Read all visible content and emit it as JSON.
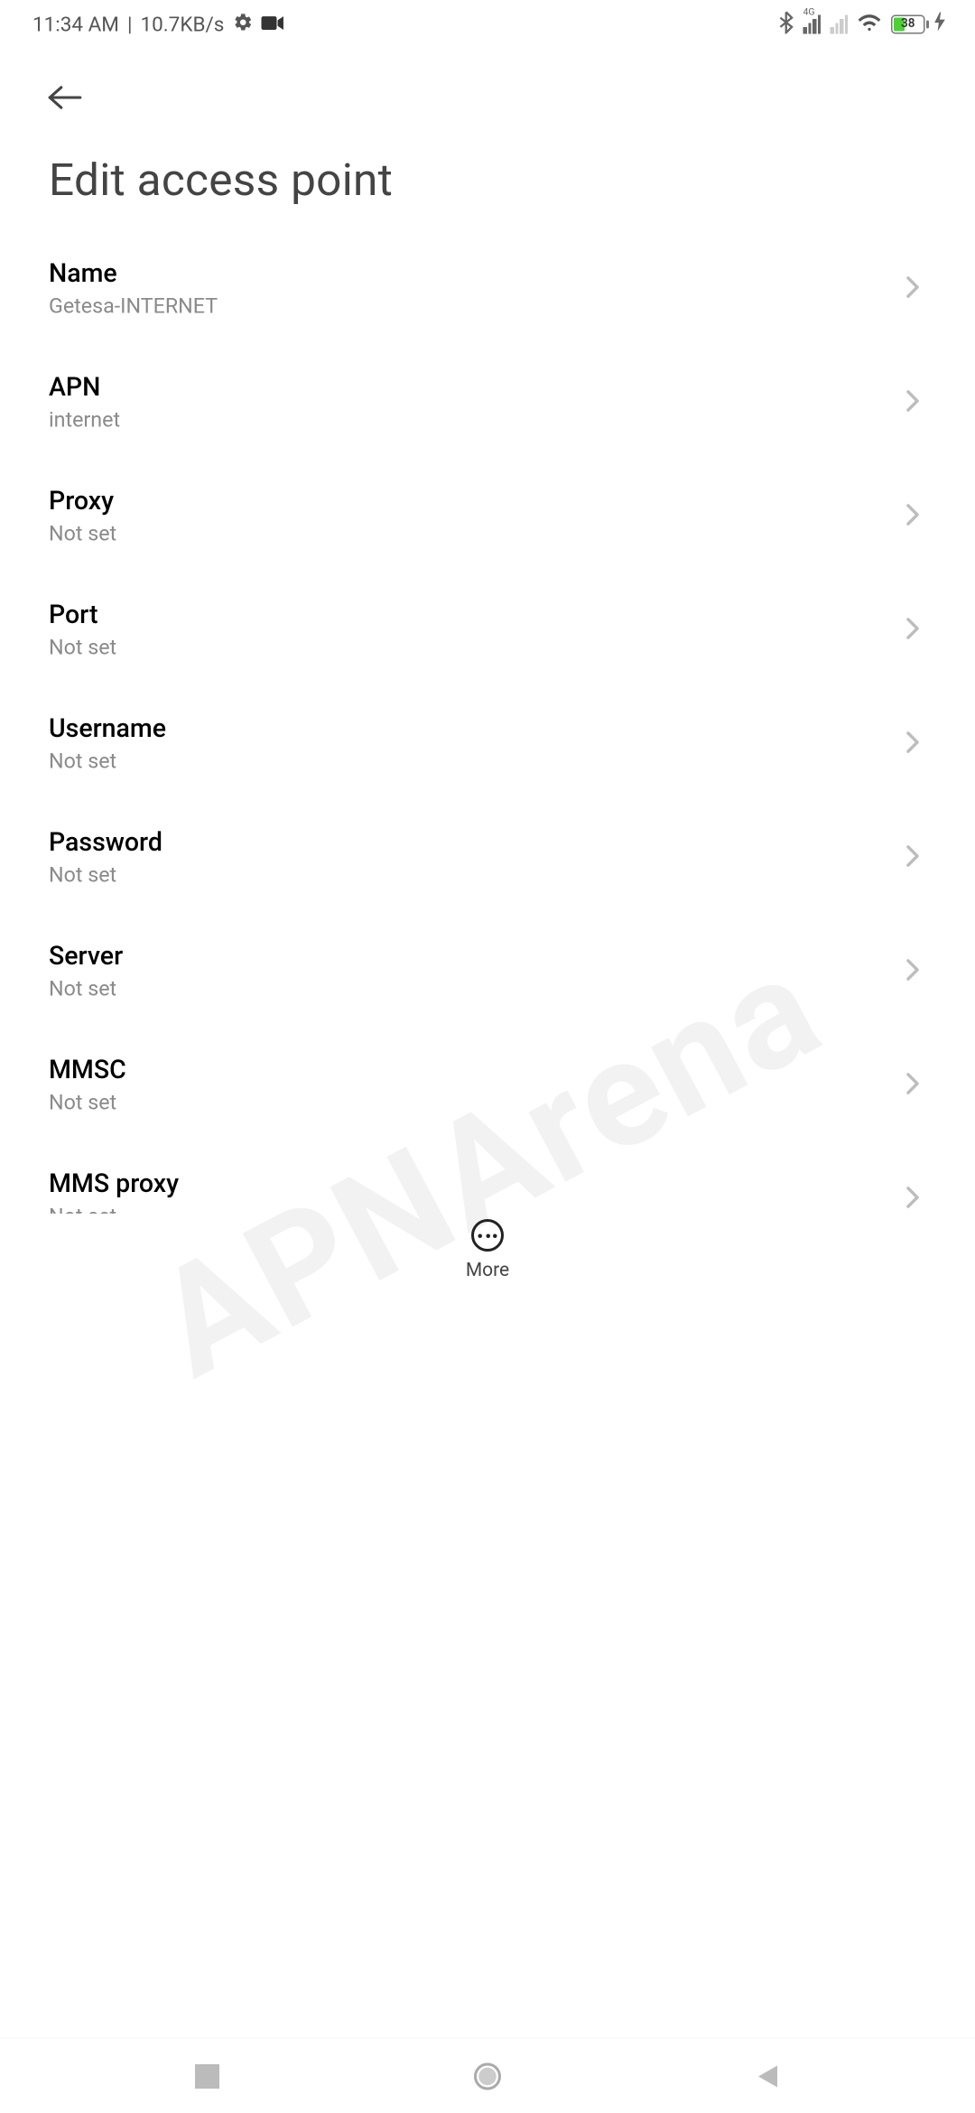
{
  "status_bar": {
    "time": "11:34 AM",
    "net_speed": "10.7KB/s",
    "battery_pct": "38",
    "4g": "4G"
  },
  "header": {
    "title": "Edit access point"
  },
  "fields": [
    {
      "label": "Name",
      "value": "Getesa-INTERNET"
    },
    {
      "label": "APN",
      "value": "internet"
    },
    {
      "label": "Proxy",
      "value": "Not set"
    },
    {
      "label": "Port",
      "value": "Not set"
    },
    {
      "label": "Username",
      "value": "Not set"
    },
    {
      "label": "Password",
      "value": "Not set"
    },
    {
      "label": "Server",
      "value": "Not set"
    },
    {
      "label": "MMSC",
      "value": "Not set"
    },
    {
      "label": "MMS proxy",
      "value": "Not set"
    }
  ],
  "more_label": "More",
  "watermark": "APNArena"
}
